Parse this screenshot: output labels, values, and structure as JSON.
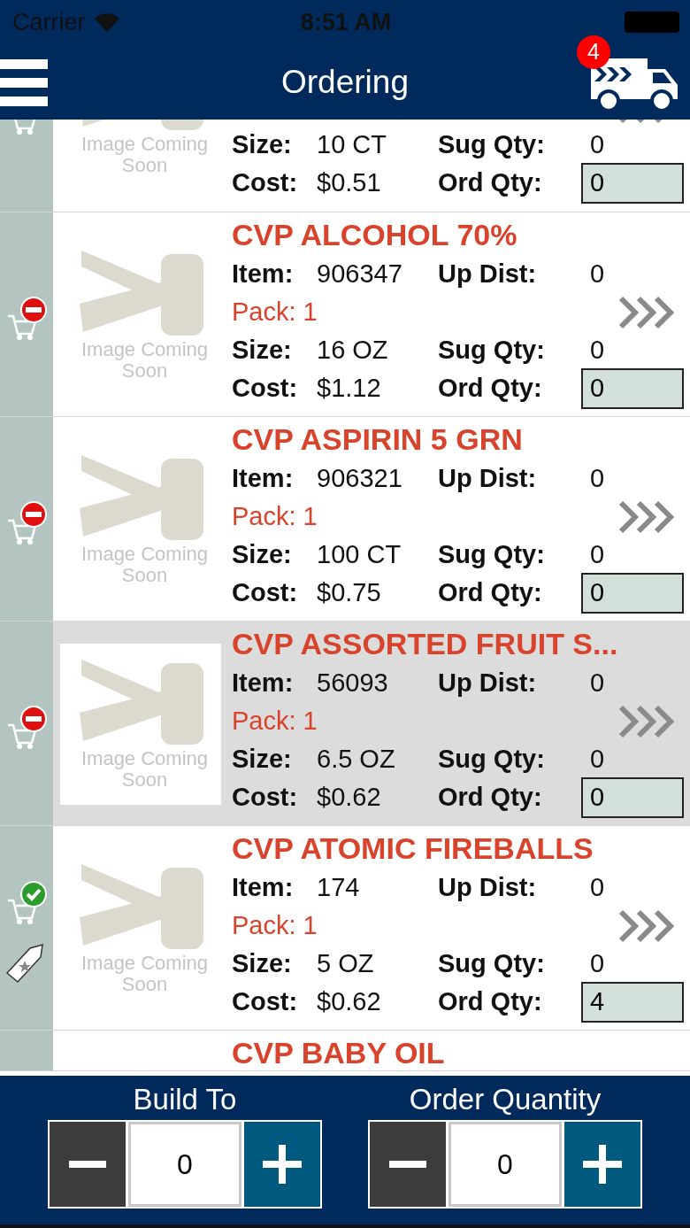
{
  "status_bar": {
    "carrier": "Carrier",
    "time": "8:51 AM"
  },
  "nav": {
    "title": "Ordering",
    "cart_count": "4"
  },
  "items": [
    {
      "kind": "partial_top",
      "selected": false,
      "promo": false,
      "image_caption": "Image Coming Soon",
      "size": {
        "label": "Size:",
        "value": "10 CT"
      },
      "sug_qty": {
        "label": "Sug Qty:",
        "value": "0"
      },
      "cost": {
        "label": "Cost:",
        "value": "$0.51"
      },
      "ord_qty": {
        "label": "Ord Qty:",
        "value": "0"
      }
    },
    {
      "kind": "full",
      "selected": false,
      "in_order": false,
      "promo": false,
      "image_caption": "Image Coming Soon",
      "title": "CVP ALCOHOL 70%",
      "item": {
        "label": "Item:",
        "value": "906347"
      },
      "up_dist": {
        "label": "Up Dist:",
        "value": "0"
      },
      "pack": {
        "label": "Pack:",
        "value": "1"
      },
      "size": {
        "label": "Size:",
        "value": "16 OZ"
      },
      "sug_qty": {
        "label": "Sug Qty:",
        "value": "0"
      },
      "cost": {
        "label": "Cost:",
        "value": "$1.12"
      },
      "ord_qty": {
        "label": "Ord Qty:",
        "value": "0"
      }
    },
    {
      "kind": "full",
      "selected": false,
      "in_order": false,
      "promo": false,
      "image_caption": "Image Coming Soon",
      "title": "CVP ASPIRIN 5 GRN",
      "item": {
        "label": "Item:",
        "value": "906321"
      },
      "up_dist": {
        "label": "Up Dist:",
        "value": "0"
      },
      "pack": {
        "label": "Pack:",
        "value": "1"
      },
      "size": {
        "label": "Size:",
        "value": "100 CT"
      },
      "sug_qty": {
        "label": "Sug Qty:",
        "value": "0"
      },
      "cost": {
        "label": "Cost:",
        "value": "$0.75"
      },
      "ord_qty": {
        "label": "Ord Qty:",
        "value": "0"
      }
    },
    {
      "kind": "full",
      "selected": true,
      "in_order": false,
      "promo": false,
      "image_caption": "Image Coming Soon",
      "title": "CVP ASSORTED FRUIT S...",
      "item": {
        "label": "Item:",
        "value": "56093"
      },
      "up_dist": {
        "label": "Up Dist:",
        "value": "0"
      },
      "pack": {
        "label": "Pack:",
        "value": "1"
      },
      "size": {
        "label": "Size:",
        "value": "6.5 OZ"
      },
      "sug_qty": {
        "label": "Sug Qty:",
        "value": "0"
      },
      "cost": {
        "label": "Cost:",
        "value": "$0.62"
      },
      "ord_qty": {
        "label": "Ord Qty:",
        "value": "0"
      }
    },
    {
      "kind": "full",
      "selected": false,
      "in_order": true,
      "promo": true,
      "image_caption": "Image Coming Soon",
      "title": "CVP ATOMIC FIREBALLS",
      "item": {
        "label": "Item:",
        "value": "174"
      },
      "up_dist": {
        "label": "Up Dist:",
        "value": "0"
      },
      "pack": {
        "label": "Pack:",
        "value": "1"
      },
      "size": {
        "label": "Size:",
        "value": "5 OZ"
      },
      "sug_qty": {
        "label": "Sug Qty:",
        "value": "0"
      },
      "cost": {
        "label": "Cost:",
        "value": "$0.62"
      },
      "ord_qty": {
        "label": "Ord Qty:",
        "value": "4"
      }
    },
    {
      "kind": "partial_bottom",
      "selected": false,
      "title": "CVP BABY OIL"
    }
  ],
  "steppers": [
    {
      "label": "Build To",
      "value": "0"
    },
    {
      "label": "Order Quantity",
      "value": "0"
    }
  ]
}
